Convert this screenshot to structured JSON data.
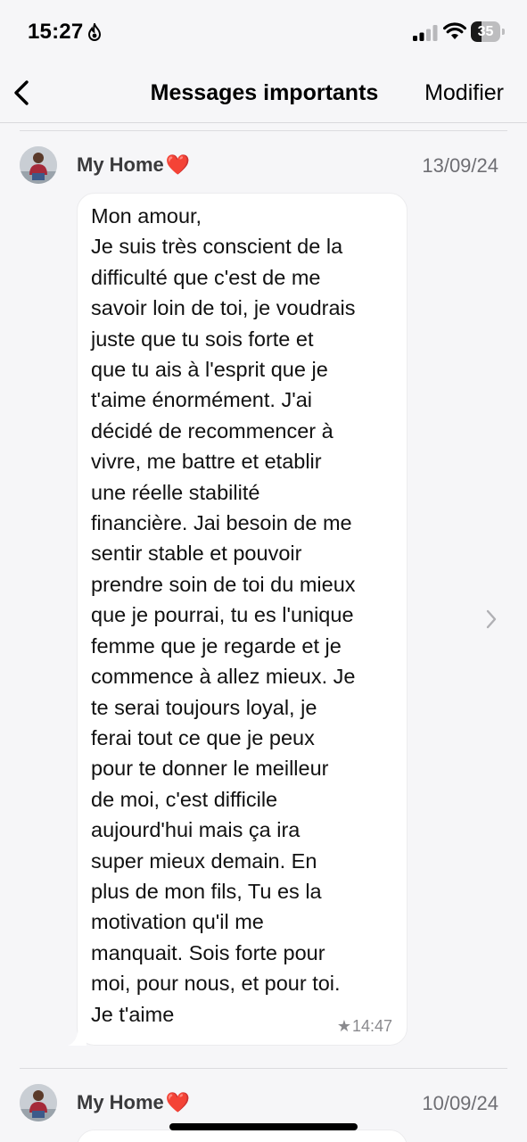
{
  "status_bar": {
    "time": "15:27",
    "focus_icon": "flame-icon",
    "battery_percent": "35",
    "battery_level": 0.35
  },
  "nav": {
    "back_icon": "chevron-left-icon",
    "title": "Messages importants",
    "edit_label": "Modifier"
  },
  "messages": [
    {
      "sender": "My Home",
      "heart": "❤️",
      "date": "13/09/24",
      "text": "Mon amour,\nJe suis très conscient de la\ndifficulté que c'est de me\nsavoir loin de toi, je voudrais\njuste que tu sois forte et\nque tu ais à l'esprit que je\nt'aime énormément. J'ai\ndécidé de recommencer à\nvivre, me battre et etablir\nune réelle stabilité\nfinancière. Jai besoin de me\nsentir stable et pouvoir\nprendre soin de toi du mieux\nque je pourrai, tu es l'unique\nfemme que je regarde et je\ncommence à allez mieux. Je\nte serai toujours loyal, je\nferai tout ce que je peux\npour te donner le meilleur\nde moi, c'est difficile\naujourd'hui mais ça ira\nsuper mieux demain. En\nplus de mon fils, Tu es la\nmotivation qu'il me\nmanquait. Sois forte pour\nmoi, pour nous, et pour toi.\nJe t'aime",
      "star": "★",
      "time": "14:47"
    },
    {
      "sender": "My Home",
      "heart": "❤️",
      "date": "10/09/24"
    }
  ]
}
